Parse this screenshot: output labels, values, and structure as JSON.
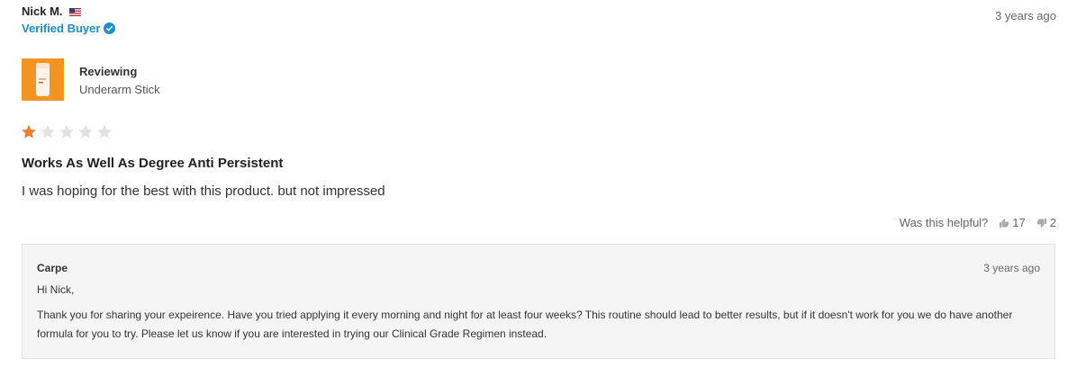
{
  "review": {
    "reviewer_name": "Nick M.",
    "reviewer_flag": "us-flag-icon",
    "verified_label": "Verified Buyer",
    "date": "3 years ago",
    "reviewing_label": "Reviewing",
    "product_name": "Underarm Stick",
    "rating": 1,
    "rating_max": 5,
    "title": "Works As Well As Degree Anti Persistent",
    "body": "I was hoping for the best with this product. but not impressed"
  },
  "helpful": {
    "label": "Was this helpful?",
    "upvotes": "17",
    "downvotes": "2"
  },
  "reply": {
    "author": "Carpe",
    "date": "3 years ago",
    "greeting": "Hi Nick,",
    "text": "Thank you for sharing your expeirence. Have you tried applying it every morning and night for at least four weeks? This routine should lead to better results, but if it doesn't work for you we do have another formula for you to try. Please let us know if you are interested in trying our Clinical Grade Regimen instead."
  },
  "colors": {
    "accent": "#1a8fc9",
    "star_filled": "#f07f2d",
    "star_empty": "#e2e2e2",
    "thumb_bg": "#f39322"
  }
}
